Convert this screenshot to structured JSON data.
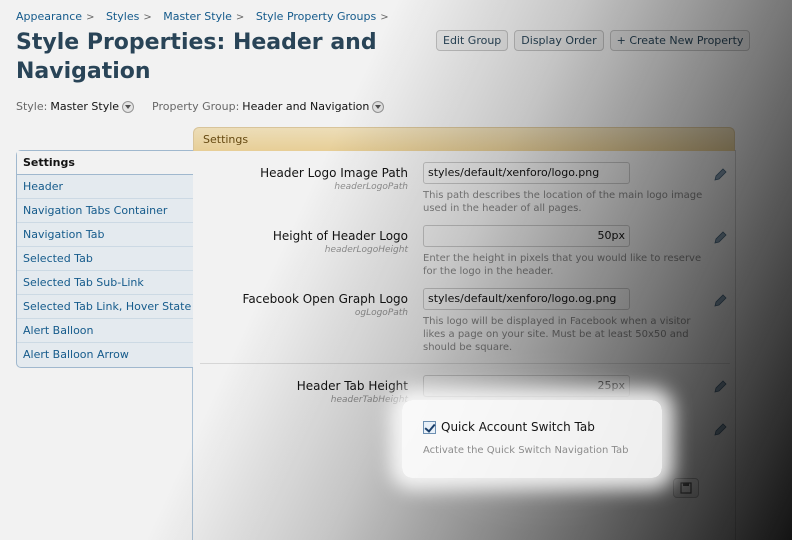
{
  "breadcrumb": [
    {
      "label": "Appearance"
    },
    {
      "label": "Styles"
    },
    {
      "label": "Master Style"
    },
    {
      "label": "Style Property Groups"
    }
  ],
  "breadcrumb_sep": ">",
  "page_title": "Style Properties: Header and Navigation",
  "top_buttons": {
    "edit_group": "Edit Group",
    "display_order": "Display Order",
    "extra": "+ Create New Property"
  },
  "filters": {
    "style_label": "Style:",
    "style_value": "Master Style",
    "group_label": "Property Group:",
    "group_value": "Header and Navigation"
  },
  "settings_header": "Settings",
  "tabs": [
    {
      "label": "Settings",
      "active": true
    },
    {
      "label": "Header"
    },
    {
      "label": "Navigation Tabs Container"
    },
    {
      "label": "Navigation Tab"
    },
    {
      "label": "Selected Tab"
    },
    {
      "label": "Selected Tab Sub-Link"
    },
    {
      "label": "Selected Tab Link, Hover State"
    },
    {
      "label": "Alert Balloon"
    },
    {
      "label": "Alert Balloon Arrow"
    }
  ],
  "properties": [
    {
      "label": "Header Logo Image Path",
      "key": "headerLogoPath",
      "value": "styles/default/xenforo/logo.png",
      "description": "This path describes the location of the main logo image used in the header of all pages."
    },
    {
      "label": "Height of Header Logo",
      "key": "headerLogoHeight",
      "value": "50px",
      "description": "Enter the height in pixels that you would like to reserve for the logo in the header."
    },
    {
      "label": "Facebook Open Graph Logo",
      "key": "ogLogoPath",
      "value": "styles/default/xenforo/logo.og.png",
      "description": "This logo will be displayed in Facebook when a visitor likes a page on your site. Must be at least 50x50 and should be square."
    },
    {
      "label": "Header Tab Height",
      "key": "headerTabHeight",
      "value": "25px",
      "description": ""
    }
  ],
  "checkbox": {
    "label": "Quick Account Switch Tab",
    "checked": true,
    "description": "Activate the Quick Switch Navigation Tab"
  },
  "icons": {
    "edit": "pencil-edit-icon",
    "save": "save-icon",
    "dropdown": "chevron-down-icon",
    "check": "checkmark-icon"
  },
  "colors": {
    "link": "#176093",
    "header_bg": "#f3d99e",
    "tab_bg": "#f0f7fc"
  }
}
